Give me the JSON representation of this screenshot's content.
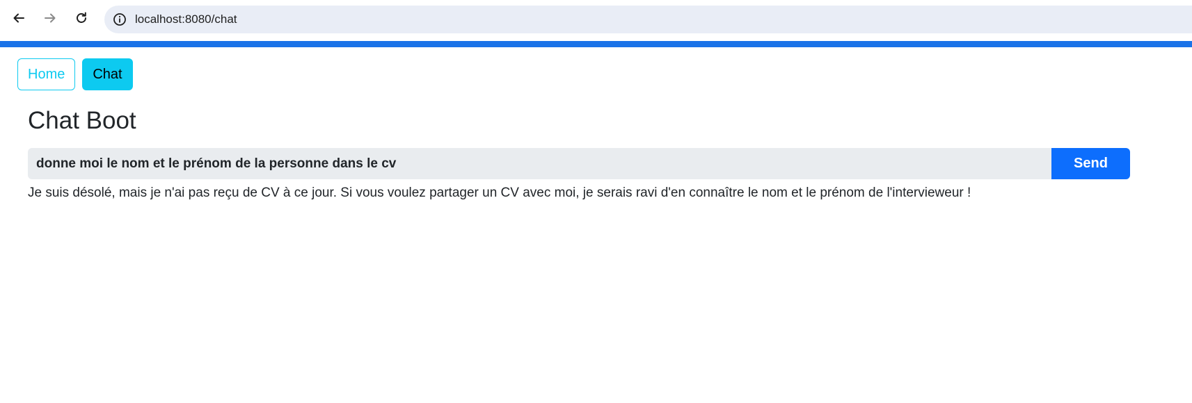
{
  "browser": {
    "url": "localhost:8080/chat",
    "icons": {
      "back": "arrow-left-icon",
      "forward": "arrow-right-icon",
      "reload": "reload-icon",
      "site_info": "info-circle-icon"
    },
    "accent_color": "#1a73e8"
  },
  "nav": {
    "home_label": "Home",
    "chat_label": "Chat",
    "accent_color": "#0dcaf0"
  },
  "page": {
    "title": "Chat Boot"
  },
  "chat": {
    "input_value": "donne moi le nom et le prénom de la personne dans le cv",
    "send_label": "Send",
    "send_color": "#0d6efd",
    "response": "Je suis désolé, mais je n'ai pas reçu de CV à ce jour. Si vous voulez partager un CV avec moi, je serais ravi d'en connaître le nom et le prénom de l'intervieweur !"
  }
}
